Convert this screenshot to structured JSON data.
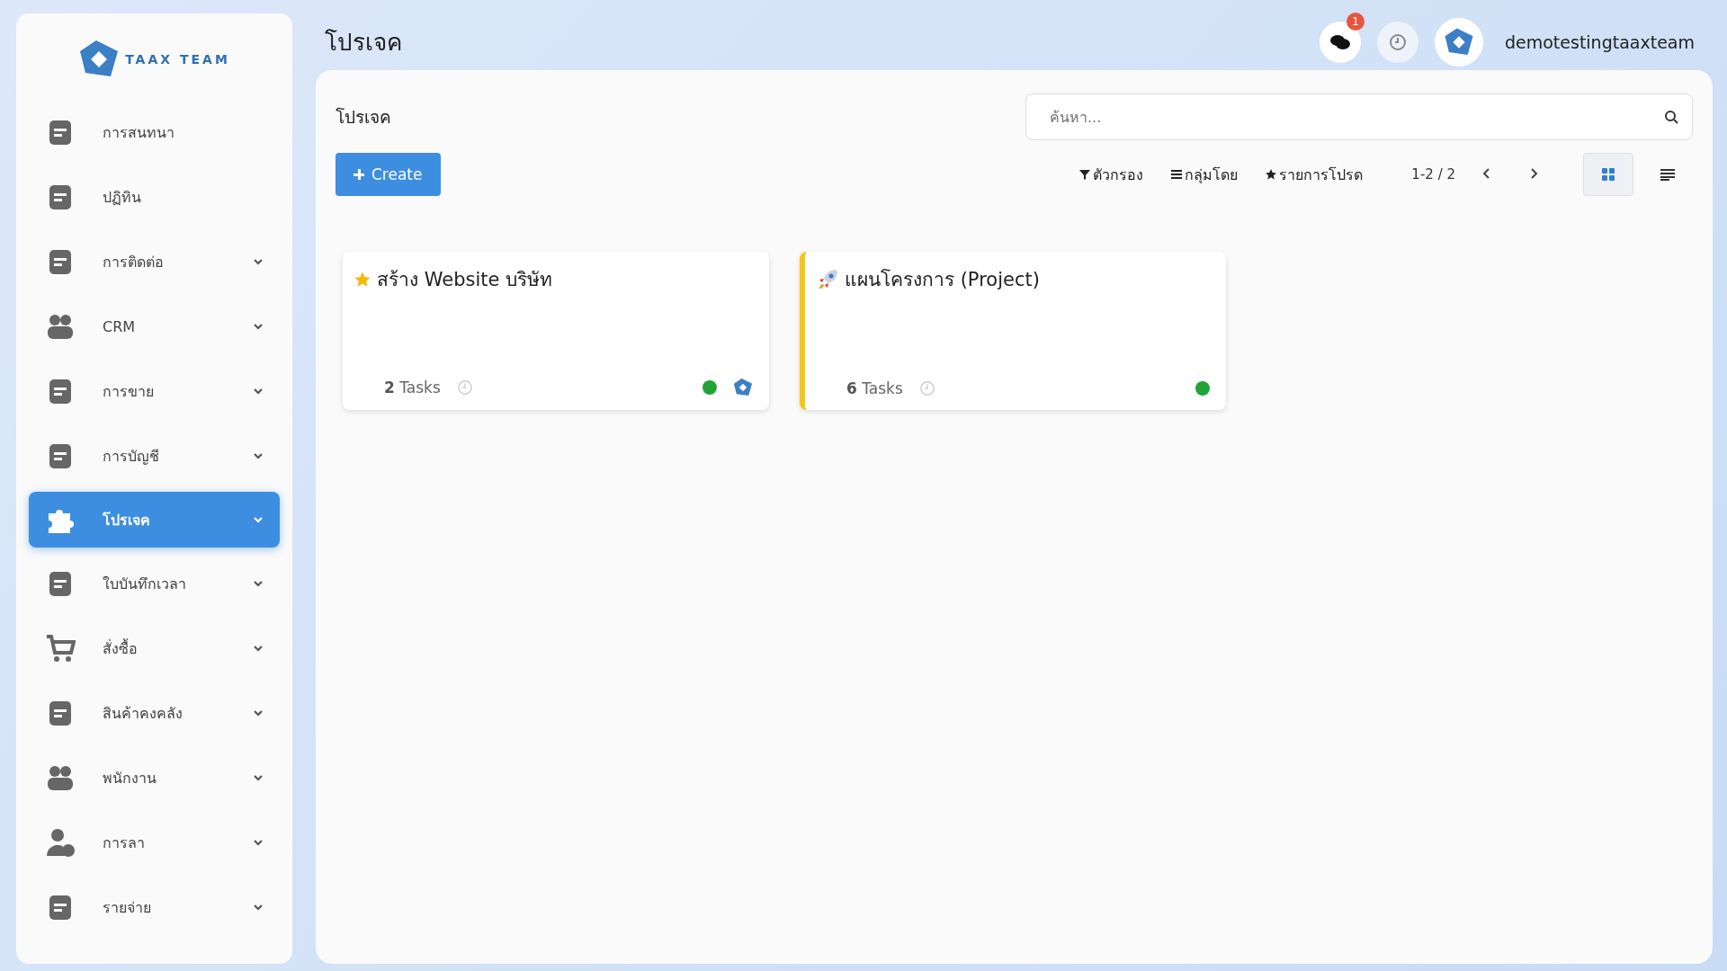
{
  "brand": {
    "name": "TAAX TEAM"
  },
  "sidebar": {
    "items": [
      {
        "label": "การสนทนา",
        "expandable": false,
        "selected": false
      },
      {
        "label": "ปฏิทิน",
        "expandable": false,
        "selected": false
      },
      {
        "label": "การติดต่อ",
        "expandable": true,
        "selected": false
      },
      {
        "label": "CRM",
        "expandable": true,
        "selected": false
      },
      {
        "label": "การขาย",
        "expandable": true,
        "selected": false
      },
      {
        "label": "การบัญชี",
        "expandable": true,
        "selected": false
      },
      {
        "label": "โปรเจค",
        "expandable": true,
        "selected": true
      },
      {
        "label": "ใบบันทึกเวลา",
        "expandable": true,
        "selected": false
      },
      {
        "label": "สั่งซื้อ",
        "expandable": true,
        "selected": false
      },
      {
        "label": "สินค้าคงคลัง",
        "expandable": true,
        "selected": false
      },
      {
        "label": "พนักงาน",
        "expandable": true,
        "selected": false
      },
      {
        "label": "การลา",
        "expandable": true,
        "selected": false
      },
      {
        "label": "รายจ่าย",
        "expandable": true,
        "selected": false
      }
    ]
  },
  "header": {
    "title": "โปรเจค",
    "chat_badge": "1",
    "username": "demotestingtaaxteam"
  },
  "panel": {
    "breadcrumb": "โปรเจค",
    "search": {
      "placeholder": "ค้นหา..."
    },
    "create_button": "Create",
    "filters": [
      "ตัวกรอง",
      "กลุ่มโดย",
      "รายการโปรด"
    ],
    "pager": "1-2 / 2",
    "views": [
      {
        "kind": "kanban",
        "selected": true
      },
      {
        "kind": "list",
        "selected": false
      }
    ]
  },
  "cards": [
    {
      "title": "สร้าง Website บริษัท",
      "favorite": true,
      "rocket": false,
      "count": "2",
      "count_label": "Tasks",
      "avatar": true
    },
    {
      "title": "แผนโครงการ (Project)",
      "favorite": false,
      "rocket": true,
      "color": "#f5c518",
      "count": "6",
      "count_label": "Tasks",
      "avatar": false
    }
  ]
}
